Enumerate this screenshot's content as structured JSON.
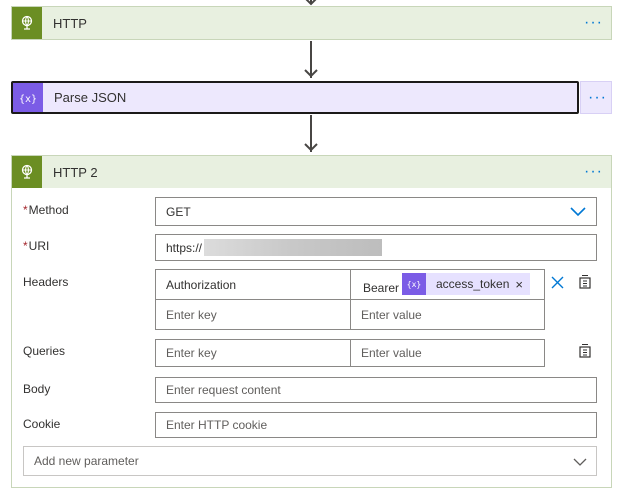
{
  "steps": {
    "http": {
      "title": "HTTP",
      "icon": "globe-icon",
      "color": "#6b8e23",
      "more_label": "···"
    },
    "parse_json": {
      "title": "Parse JSON",
      "icon": "parse-json-icon",
      "color": "#7b5ce6",
      "more_label": "···"
    },
    "http2": {
      "title": "HTTP 2",
      "icon": "globe-icon",
      "color": "#6b8e23",
      "more_label": "···"
    }
  },
  "form": {
    "method": {
      "label": "Method",
      "required_mark": "*",
      "value": "GET"
    },
    "uri": {
      "label": "URI",
      "required_mark": "*",
      "value": "https://"
    },
    "headers": {
      "label": "Headers",
      "row1": {
        "key": "Authorization",
        "value_prefix": "Bearer",
        "token_label": "access_token",
        "token_remove": "×"
      },
      "row2": {
        "key_placeholder": "Enter key",
        "value_placeholder": "Enter value"
      }
    },
    "queries": {
      "label": "Queries",
      "key_placeholder": "Enter key",
      "value_placeholder": "Enter value"
    },
    "body": {
      "label": "Body",
      "placeholder": "Enter request content"
    },
    "cookie": {
      "label": "Cookie",
      "placeholder": "Enter HTTP cookie"
    },
    "add_param": {
      "placeholder": "Add new parameter"
    }
  },
  "colors": {
    "accent": "#0078d4",
    "http_header_bg": "#e8f0e0",
    "parse_header_bg": "#ede8fd",
    "token_bg": "#e6e1ff"
  }
}
